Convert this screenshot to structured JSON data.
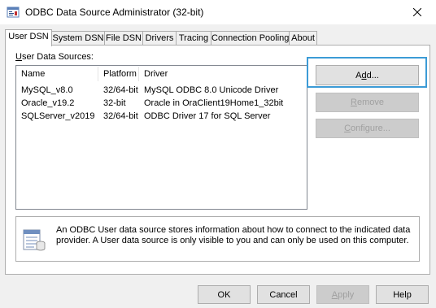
{
  "window": {
    "title": "ODBC Data Source Administrator (32-bit)"
  },
  "tabs": [
    {
      "label": "User DSN",
      "active": true
    },
    {
      "label": "System DSN",
      "active": false
    },
    {
      "label": "File DSN",
      "active": false
    },
    {
      "label": "Drivers",
      "active": false
    },
    {
      "label": "Tracing",
      "active": false
    },
    {
      "label": "Connection Pooling",
      "active": false
    },
    {
      "label": "About",
      "active": false
    }
  ],
  "sources_label": {
    "pre": "",
    "ul": "U",
    "post": "ser Data Sources:"
  },
  "columns": [
    "Name",
    "Platform",
    "Driver"
  ],
  "rows": [
    {
      "name": "MySQL_v8.0",
      "platform": "32/64-bit",
      "driver": "MySQL ODBC 8.0 Unicode Driver"
    },
    {
      "name": "Oracle_v19.2",
      "platform": "32-bit",
      "driver": "Oracle in OraClient19Home1_32bit"
    },
    {
      "name": "SQLServer_v2019",
      "platform": "32/64-bit",
      "driver": "ODBC Driver 17 for SQL Server"
    }
  ],
  "side_buttons": {
    "add": {
      "pre": "A",
      "ul": "d",
      "post": "d..."
    },
    "remove": {
      "pre": "",
      "ul": "R",
      "post": "emove"
    },
    "configure": {
      "pre": "",
      "ul": "C",
      "post": "onfigure..."
    }
  },
  "info_text": "An ODBC User data source stores information about how to connect to the indicated data provider.   A User data source is only visible to you and can only be used on this computer.",
  "bottom_buttons": {
    "ok": "OK",
    "cancel": "Cancel",
    "apply": {
      "pre": "",
      "ul": "A",
      "post": "pply"
    },
    "help": "Help"
  },
  "colors": {
    "focus_accent": "#3c9bd6",
    "disabled_text": "#a0a0a0"
  }
}
